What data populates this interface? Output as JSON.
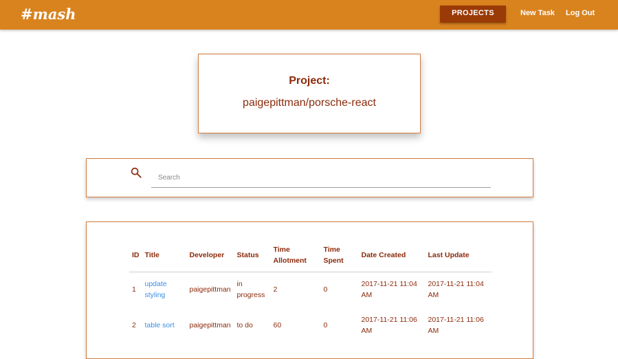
{
  "navbar": {
    "brand": "#mash",
    "projects_label": "PROJECTS",
    "new_task_label": "New Task",
    "logout_label": "Log Out",
    "color": "#d9831f",
    "active_color": "#9a3a07"
  },
  "project": {
    "label": "Project:",
    "name": "paigepittman/porsche-react"
  },
  "search": {
    "placeholder": "Search",
    "icon": "search-icon"
  },
  "table": {
    "headers": {
      "id": "ID",
      "title": "Title",
      "developer": "Developer",
      "status": "Status",
      "time_allotment": "Time Allotment",
      "time_spent": "Time Spent",
      "date_created": "Date Created",
      "last_update": "Last Update"
    },
    "rows": [
      {
        "id": "1",
        "title": "update styling",
        "developer": "paigepittman",
        "status": "in progress",
        "time_allotment": "2",
        "time_spent": "0",
        "date_created": "2017-11-21 11:04 AM",
        "last_update": "2017-11-21 11:04 AM"
      },
      {
        "id": "2",
        "title": "table sort",
        "developer": "paigepittman",
        "status": "to do",
        "time_allotment": "60",
        "time_spent": "0",
        "date_created": "2017-11-21 11:06 AM",
        "last_update": "2017-11-21 11:06 AM"
      }
    ]
  }
}
